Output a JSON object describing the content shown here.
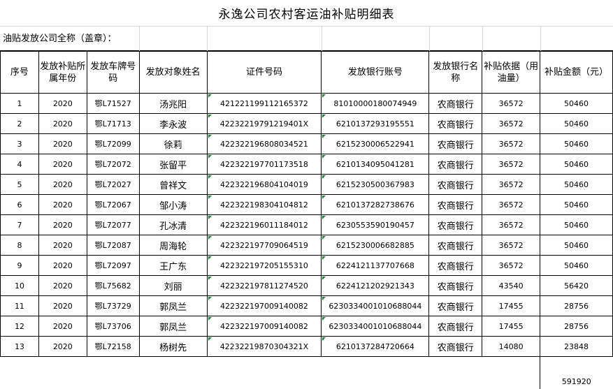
{
  "title": "永逸公司农村客运油补贴明细表",
  "issuer_label": "油贴发放公司全称（盖章）：",
  "headers": [
    "序号",
    "发放补贴所属年份",
    "发放车牌号码",
    "发放对象姓名",
    "证件号码",
    "发放银行账号",
    "发放银行名称",
    "补贴依据（用油量）",
    "补贴金额（元）"
  ],
  "rows": [
    {
      "no": "1",
      "year": "2020",
      "plate": "鄂L71527",
      "name": "汤兆阳",
      "id": "421221199112165372",
      "account": "81010000180074949",
      "bank": "农商银行",
      "fuel": "36572",
      "amount": "50460"
    },
    {
      "no": "2",
      "year": "2020",
      "plate": "鄂L71713",
      "name": "李永波",
      "id": "42232219791219401X",
      "account": "6210137293195551",
      "bank": "农商银行",
      "fuel": "36572",
      "amount": "50460"
    },
    {
      "no": "3",
      "year": "2020",
      "plate": "鄂L72099",
      "name": "徐莉",
      "id": "422322196808034521",
      "account": "6215230006522941",
      "bank": "农商银行",
      "fuel": "36572",
      "amount": "50460"
    },
    {
      "no": "4",
      "year": "2020",
      "plate": "鄂L72072",
      "name": "张留平",
      "id": "422322197701173518",
      "account": "6210134095041281",
      "bank": "农商银行",
      "fuel": "36572",
      "amount": "50460"
    },
    {
      "no": "5",
      "year": "2020",
      "plate": "鄂L72027",
      "name": "曾祥文",
      "id": "422322196804104019",
      "account": "6215230500367983",
      "bank": "农商银行",
      "fuel": "36572",
      "amount": "50460"
    },
    {
      "no": "6",
      "year": "2020",
      "plate": "鄂L72067",
      "name": "邹小涛",
      "id": "422322198304104812",
      "account": "6210137282738676",
      "bank": "农商银行",
      "fuel": "36572",
      "amount": "50460"
    },
    {
      "no": "7",
      "year": "2020",
      "plate": "鄂L72077",
      "name": "孔冰清",
      "id": "422322196011184012",
      "account": "6230553590190457",
      "bank": "农商银行",
      "fuel": "36572",
      "amount": "50460"
    },
    {
      "no": "8",
      "year": "2020",
      "plate": "鄂L72087",
      "name": "周海轮",
      "id": "422322197709064519",
      "account": "6215230006682885",
      "bank": "农商银行",
      "fuel": "36572",
      "amount": "50460"
    },
    {
      "no": "9",
      "year": "2020",
      "plate": "鄂L72097",
      "name": "王广东",
      "id": "422322197205155310",
      "account": "6224121137707668",
      "bank": "农商银行",
      "fuel": "36572",
      "amount": "50460"
    },
    {
      "no": "10",
      "year": "2020",
      "plate": "鄂L75682",
      "name": "刘丽",
      "id": "422322197811274520",
      "account": "6224121202921343",
      "bank": "农商银行",
      "fuel": "43540",
      "amount": "56420"
    },
    {
      "no": "11",
      "year": "2020",
      "plate": "鄂L73729",
      "name": "郭凤兰",
      "id": "422322197009140082",
      "account": "6230334001010688044",
      "bank": "农商银行",
      "fuel": "17455",
      "amount": "28756"
    },
    {
      "no": "12",
      "year": "2020",
      "plate": "鄂L73706",
      "name": "郭凤兰",
      "id": "422322197009140082",
      "account": "6230334001010688044",
      "bank": "农商银行",
      "fuel": "17455",
      "amount": "28756"
    },
    {
      "no": "13",
      "year": "2020",
      "plate": "鄂L72158",
      "name": "杨树先",
      "id": "42232219870304321X",
      "account": "6210137284720664",
      "bank": "农商银行",
      "fuel": "14080",
      "amount": "23848"
    }
  ],
  "total": "591920"
}
